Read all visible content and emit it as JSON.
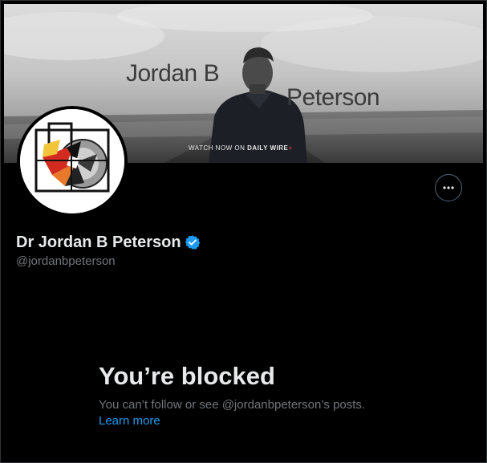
{
  "banner": {
    "name_part1": "Jordan B",
    "name_part2": "Peterson",
    "watch_prefix": "WATCH NOW ON ",
    "watch_brand": "DAILY WIRE",
    "watch_plus": "+"
  },
  "profile": {
    "display_name": "Dr Jordan B Peterson",
    "handle": "@jordanbpeterson",
    "verified": true,
    "verified_color": "#1d9bf0"
  },
  "actions": {
    "more_icon": "more-horizontal-icon"
  },
  "blocked": {
    "title": "You’re blocked",
    "description": "You can’t follow or see @jordanbpeterson’s posts.",
    "learn_more": "Learn more"
  },
  "colors": {
    "background": "#000000",
    "text_primary": "#e7e9ea",
    "text_secondary": "#71767b",
    "link": "#1d9bf0",
    "border": "#536471"
  }
}
